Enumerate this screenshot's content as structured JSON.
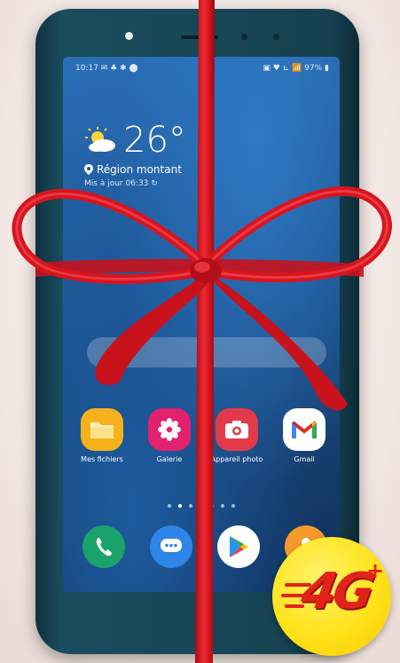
{
  "status_bar": {
    "time": "10:17 ✉ ♣ ✱ ⬤",
    "icons": "▣ ♥ ⊾ 📶 97% ▮"
  },
  "weather": {
    "temperature": "26°",
    "location": "Région montant",
    "updated": "Mis à jour 06:33 ↻",
    "icon": "sun-cloud-icon"
  },
  "apps": [
    {
      "label": "Mes fichiers",
      "icon": "folder-icon",
      "color": "#f5b21c"
    },
    {
      "label": "Galerie",
      "icon": "flower-icon",
      "color": "#e2226f"
    },
    {
      "label": "Appareil photo",
      "icon": "camera-icon",
      "color": "#e23a4a"
    },
    {
      "label": "Gmail",
      "icon": "gmail-icon",
      "color": "#ffffff"
    }
  ],
  "dock": [
    {
      "icon": "phone-icon",
      "color": "#1aa36b"
    },
    {
      "icon": "messages-icon",
      "color": "#2e86e8"
    },
    {
      "icon": "play-store-icon",
      "color": "#ffffff"
    },
    {
      "icon": "contacts-icon",
      "color": "#f39a2a"
    }
  ],
  "page_dots": 7,
  "badge": {
    "text": "4G",
    "suffix": "+"
  },
  "colors": {
    "ribbon": "#d8141f",
    "phone": "#16404f",
    "badge": "#ffe21a",
    "badge_text": "#e2231a"
  }
}
